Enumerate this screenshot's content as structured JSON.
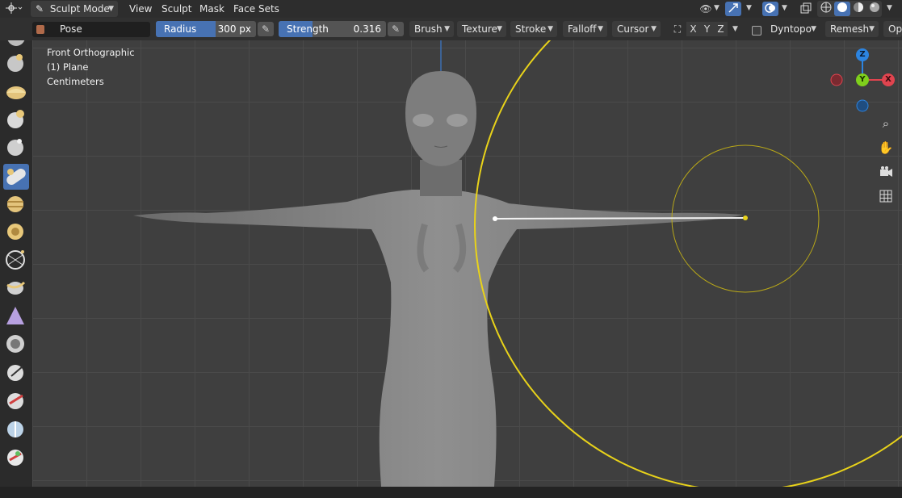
{
  "header": {
    "mode_label": "Sculpt Mode",
    "menus": [
      "View",
      "Sculpt",
      "Mask",
      "Face Sets"
    ]
  },
  "toolbar": {
    "brush_name": "Pose",
    "radius": {
      "label": "Radius",
      "value": "300 px",
      "fraction": 0.6
    },
    "strength": {
      "label": "Strength",
      "value": "0.316",
      "fraction": 0.316
    },
    "dropdowns": [
      "Brush",
      "Texture",
      "Stroke",
      "Falloff",
      "Cursor"
    ],
    "symmetry_axes": [
      "X",
      "Y",
      "Z"
    ],
    "dyntopo_label": "Dyntopo",
    "remesh_label": "Remesh",
    "options_label": "Opt"
  },
  "viewport": {
    "view_name": "Front Orthographic",
    "object_name": "(1) Plane",
    "units": "Centimeters"
  },
  "gizmo": {
    "z": "Z",
    "y": "Y",
    "x": "X"
  },
  "colors": {
    "accent": "#4772b3",
    "cursor": "#e8d21a",
    "x_axis": "#e0444f",
    "y_axis": "#7fd01c",
    "z_axis": "#2c84e0"
  }
}
